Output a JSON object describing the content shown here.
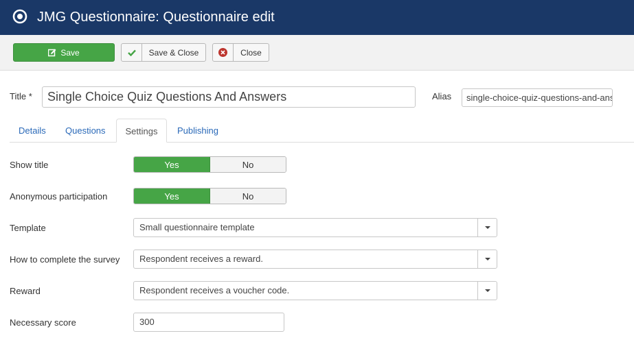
{
  "header": {
    "title": "JMG Questionnaire: Questionnaire edit",
    "icon": "radio-target-icon",
    "background": "#1a3867"
  },
  "toolbar": {
    "save_label": "Save",
    "save_close_label": "Save & Close",
    "close_label": "Close",
    "save_color": "#46a546"
  },
  "title_field": {
    "label": "Title *",
    "value": "Single Choice Quiz Questions And Answers"
  },
  "alias_field": {
    "label": "Alias",
    "value": "single-choice-quiz-questions-and-answers"
  },
  "tabs": [
    {
      "label": "Details",
      "active": false
    },
    {
      "label": "Questions",
      "active": false
    },
    {
      "label": "Settings",
      "active": true
    },
    {
      "label": "Publishing",
      "active": false
    }
  ],
  "settings": {
    "show_title": {
      "label": "Show title",
      "yes": "Yes",
      "no": "No",
      "selected": "Yes"
    },
    "anonymous": {
      "label": "Anonymous participation",
      "yes": "Yes",
      "no": "No",
      "selected": "Yes"
    },
    "template": {
      "label": "Template",
      "value": "Small questionnaire template"
    },
    "how_complete": {
      "label": "How to complete the survey",
      "value": "Respondent receives a reward."
    },
    "reward": {
      "label": "Reward",
      "value": "Respondent receives a voucher code."
    },
    "necessary_score": {
      "label": "Necessary score",
      "value": "300"
    }
  }
}
